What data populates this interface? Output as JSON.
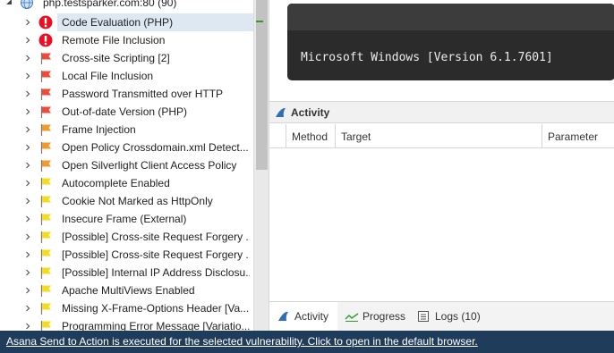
{
  "colors": {
    "critical": "#e81123",
    "high": "#f04a36",
    "medium": "#f29a2b",
    "low": "#f5dc1d",
    "selected": "#dde8f3",
    "statusbar": "#1f3c5b"
  },
  "tree": {
    "root_label": "php.testsparker.com:80 (90)",
    "items": [
      {
        "label": "Code Evaluation (PHP)",
        "severity": "critical",
        "icon": "critical-alert-icon",
        "selected": true
      },
      {
        "label": "Remote File Inclusion",
        "severity": "critical",
        "icon": "critical-alert-icon"
      },
      {
        "label": "Cross-site Scripting [2]",
        "severity": "high",
        "icon": "high-flag-icon"
      },
      {
        "label": "Local File Inclusion",
        "severity": "high",
        "icon": "high-flag-icon"
      },
      {
        "label": "Password Transmitted over HTTP",
        "severity": "high",
        "icon": "high-flag-icon"
      },
      {
        "label": "Out-of-date Version (PHP)",
        "severity": "high",
        "icon": "high-flag-icon"
      },
      {
        "label": "Frame Injection",
        "severity": "medium",
        "icon": "medium-flag-icon"
      },
      {
        "label": "Open Policy Crossdomain.xml Detect...",
        "severity": "medium",
        "icon": "medium-flag-icon"
      },
      {
        "label": "Open Silverlight Client Access Policy",
        "severity": "medium",
        "icon": "medium-flag-icon"
      },
      {
        "label": "Autocomplete Enabled",
        "severity": "low",
        "icon": "low-flag-icon"
      },
      {
        "label": "Cookie Not Marked as HttpOnly",
        "severity": "low",
        "icon": "low-flag-icon"
      },
      {
        "label": "Insecure Frame (External)",
        "severity": "low",
        "icon": "low-flag-icon"
      },
      {
        "label": "[Possible] Cross-site Request Forgery ...",
        "severity": "low",
        "icon": "low-flag-icon"
      },
      {
        "label": "[Possible] Cross-site Request Forgery ...",
        "severity": "low",
        "icon": "low-flag-icon"
      },
      {
        "label": "[Possible] Internal IP Address Disclosu...",
        "severity": "low",
        "icon": "low-flag-icon"
      },
      {
        "label": "Apache MultiViews Enabled",
        "severity": "low",
        "icon": "low-flag-icon"
      },
      {
        "label": "Missing X-Frame-Options Header [Va...",
        "severity": "low",
        "icon": "low-flag-icon"
      },
      {
        "label": "Programming Error Message [Variatio...",
        "severity": "low",
        "icon": "low-flag-icon"
      }
    ]
  },
  "console": {
    "text": "Microsoft Windows [Version 6.1.7601]"
  },
  "activity": {
    "title": "Activity",
    "columns": [
      "Method",
      "Target",
      "Parameter"
    ]
  },
  "bottom_tabs": [
    {
      "label": "Activity",
      "icon": "shark-fin-icon",
      "active": true
    },
    {
      "label": "Progress",
      "icon": "progress-wave-icon"
    },
    {
      "label": "Logs (10)",
      "icon": "logs-list-icon"
    }
  ],
  "status": {
    "message": "Asana Send to Action is executed for the selected vulnerability. Click to open in the default browser."
  }
}
